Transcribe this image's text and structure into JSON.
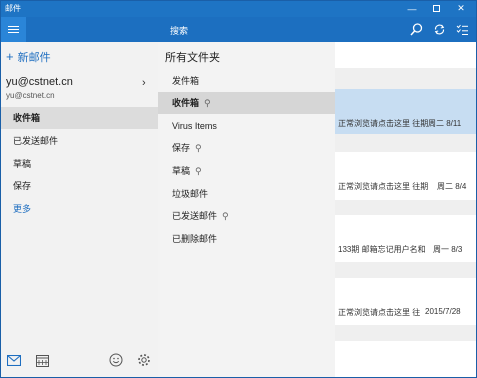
{
  "window": {
    "title": "邮件",
    "minimize_icon": "—",
    "close_icon": "✕"
  },
  "header": {
    "search_label": "搜索",
    "icons": [
      "search-icon",
      "sync-icon",
      "filter-icon"
    ]
  },
  "left_pane": {
    "new_mail_icon": "+",
    "new_mail_label": "新邮件",
    "account_name": "yu@cstnet.cn",
    "account_email": "yu@cstnet.cn",
    "account_chevron": "›",
    "folders": [
      {
        "label": "收件箱",
        "selected": true
      },
      {
        "label": "已发送邮件"
      },
      {
        "label": "草稿"
      },
      {
        "label": "保存"
      },
      {
        "label": "更多"
      }
    ],
    "bottom_icons": [
      "mail-icon",
      "calendar-icon",
      "feedback-icon",
      "settings-icon"
    ]
  },
  "flyout": {
    "title": "所有文件夹",
    "items": [
      {
        "label": "发件箱",
        "pinned": false
      },
      {
        "label": "收件箱",
        "pinned": true,
        "selected": true
      },
      {
        "label": "Virus Items",
        "pinned": false
      },
      {
        "label": "保存",
        "pinned": true
      },
      {
        "label": "草稿",
        "pinned": true
      },
      {
        "label": "垃圾邮件",
        "pinned": false
      },
      {
        "label": "已发送邮件",
        "pinned": true
      },
      {
        "label": "已删除邮件",
        "pinned": false
      }
    ],
    "pin_icon": "⚲"
  },
  "messages": [
    {
      "preview": "正常浏览请点击这里 往期",
      "date": "周二 8/11",
      "selected": true
    },
    {
      "preview": "正常浏览请点击这里 往期",
      "date": "周二 8/4"
    },
    {
      "preview": "133期 邮箱忘记用户名和",
      "date": "周一 8/3"
    },
    {
      "preview": "正常浏览请点击这里 往",
      "date": "2015/7/28"
    }
  ],
  "colors": {
    "titlebar": "#1e74c4",
    "header": "#1c6fc0",
    "accent": "#1e6ec0",
    "selected_message": "#c7ddf2"
  }
}
